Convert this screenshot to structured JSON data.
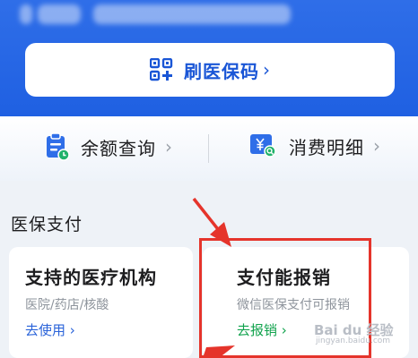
{
  "header": {
    "bg_color": "#2266e3"
  },
  "qr_button": {
    "label": "刷医保码",
    "chevron": "›",
    "icon": "qr-code-plus-icon",
    "accent": "#1a56d6"
  },
  "quick_actions": [
    {
      "label": "余额查询",
      "chevron": "›",
      "icon": "balance-clipboard-icon"
    },
    {
      "label": "消费明细",
      "chevron": "›",
      "icon": "yen-receipt-search-icon"
    }
  ],
  "section": {
    "title": "医保支付"
  },
  "cards": [
    {
      "title": "支持的医疗机构",
      "subtitle": "医院/药店/核酸",
      "link": "去使用",
      "chevron": "›",
      "link_color": "#2a63d9"
    },
    {
      "title": "支付能报销",
      "subtitle": "微信医保支付可报销",
      "link": "去报销",
      "chevron": "›",
      "link_color": "#12a34e"
    }
  ],
  "annotation": {
    "color": "#e5342b"
  },
  "watermark": {
    "text": "Bai du 经验",
    "sub": "jingyan.baidu.com"
  }
}
